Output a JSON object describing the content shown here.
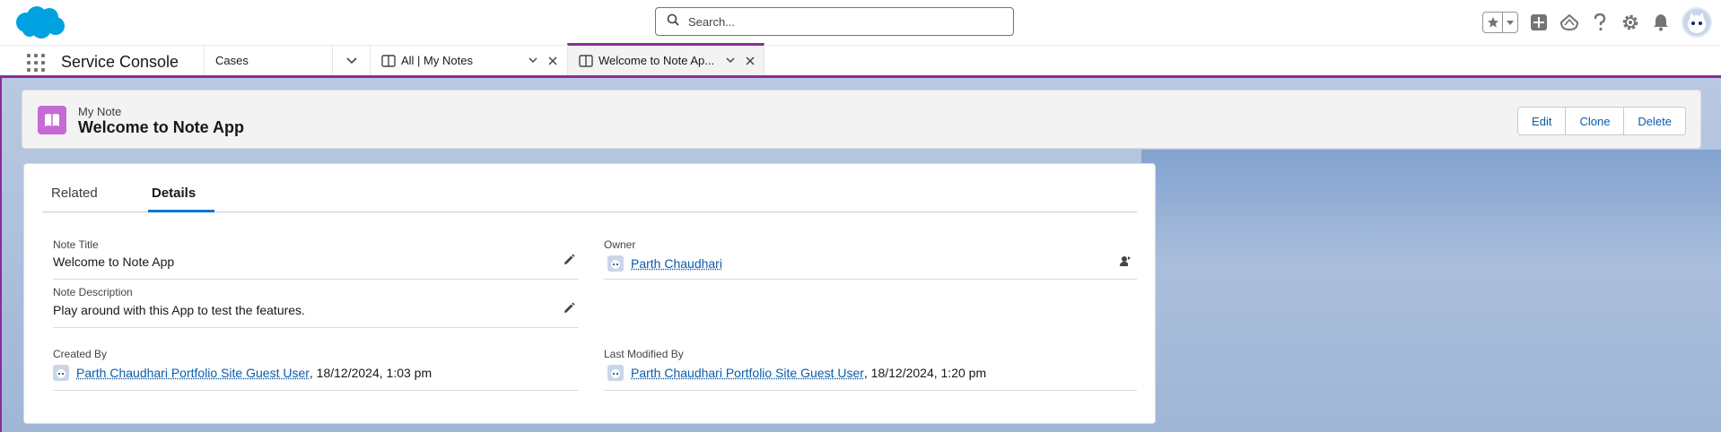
{
  "search": {
    "placeholder": "Search..."
  },
  "nav": {
    "app_name": "Service Console",
    "object_menu": "Cases",
    "tabs": [
      {
        "label": "All | My Notes"
      },
      {
        "label": "Welcome to Note Ap..."
      }
    ]
  },
  "record": {
    "type_label": "My Note",
    "title": "Welcome to Note App",
    "actions": {
      "edit": "Edit",
      "clone": "Clone",
      "delete": "Delete"
    }
  },
  "detail_tabs": {
    "related": "Related",
    "details": "Details"
  },
  "fields": {
    "note_title": {
      "label": "Note Title",
      "value": "Welcome to Note App"
    },
    "owner": {
      "label": "Owner",
      "value": "Parth Chaudhari"
    },
    "note_description": {
      "label": "Note Description",
      "value": "Play around with this App to test the features."
    },
    "created_by": {
      "label": "Created By",
      "user": "Parth Chaudhari Portfolio Site Guest User",
      "timestamp": ", 18/12/2024, 1:03 pm"
    },
    "last_modified_by": {
      "label": "Last Modified By",
      "user": "Parth Chaudhari Portfolio Site Guest User",
      "timestamp": ", 18/12/2024, 1:20 pm"
    }
  },
  "colors": {
    "brand": "#0176d3",
    "console_accent": "#8b2c98",
    "note_icon": "#c56ad4",
    "link": "#0b5cab"
  }
}
